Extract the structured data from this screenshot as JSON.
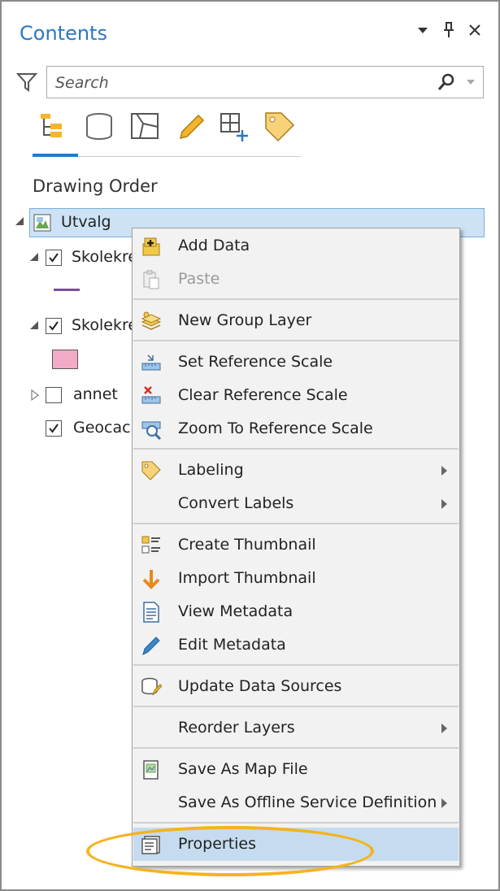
{
  "panel": {
    "title": "Contents",
    "search_placeholder": "Search",
    "section_heading": "Drawing Order"
  },
  "tree": [
    {
      "label": "Utvalg",
      "checked": null
    },
    {
      "label": "Skolekre",
      "checked": true
    },
    {
      "label": "Skolekre",
      "checked": true
    },
    {
      "label": "annet",
      "checked": false
    },
    {
      "label": "Geocacl",
      "checked": true
    }
  ],
  "menu": {
    "items": [
      {
        "label": "Add Data",
        "icon": "add-data-icon"
      },
      {
        "label": "Paste",
        "icon": "paste-icon",
        "disabled": true
      },
      {
        "label": "New Group Layer",
        "icon": "group-layer-icon"
      },
      {
        "label": "Set Reference Scale",
        "icon": "set-scale-icon"
      },
      {
        "label": "Clear Reference Scale",
        "icon": "clear-scale-icon"
      },
      {
        "label": "Zoom To Reference Scale",
        "icon": "zoom-scale-icon"
      },
      {
        "label": "Labeling",
        "icon": "label-tag-icon",
        "submenu": true
      },
      {
        "label": "Convert Labels",
        "icon": null,
        "submenu": true
      },
      {
        "label": "Create Thumbnail",
        "icon": "thumbnail-icon"
      },
      {
        "label": "Import Thumbnail",
        "icon": "import-arrow-icon"
      },
      {
        "label": "View Metadata",
        "icon": "metadata-icon"
      },
      {
        "label": "Edit Metadata",
        "icon": "edit-pencil-icon"
      },
      {
        "label": "Update Data Sources",
        "icon": "data-source-icon"
      },
      {
        "label": "Reorder Layers",
        "icon": null,
        "submenu": true
      },
      {
        "label": "Save As Map File",
        "icon": "map-file-icon"
      },
      {
        "label": "Save As Offline Service Definition",
        "icon": null,
        "submenu": true
      },
      {
        "label": "Properties",
        "icon": "properties-icon",
        "highlighted": true
      }
    ]
  },
  "colors": {
    "accent": "#2b78c2",
    "selection": "#cde3f5",
    "menu_highlight": "#c5dcf0",
    "annotation": "#f5b31c",
    "legend_line": "#7b4ea0",
    "legend_fill": "#f2aac6"
  }
}
